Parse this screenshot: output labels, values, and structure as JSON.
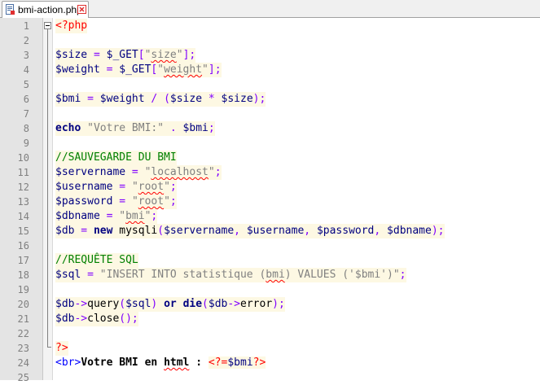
{
  "tab": {
    "filename": "bmi-action.php",
    "icon": "php-file-icon",
    "close_icon": "close-tab-icon",
    "modified_color": "#e03030"
  },
  "editor": {
    "lines": [
      {
        "num": "1",
        "php": true,
        "tokens": [
          {
            "t": "tag",
            "v": "<?php"
          }
        ]
      },
      {
        "num": "2",
        "php": true,
        "tokens": []
      },
      {
        "num": "3",
        "php": true,
        "tokens": [
          {
            "t": "var",
            "v": "$size"
          },
          {
            "t": "op",
            "v": " = "
          },
          {
            "t": "var",
            "v": "$_GET"
          },
          {
            "t": "op",
            "v": "["
          },
          {
            "t": "str",
            "v": "\""
          },
          {
            "t": "str",
            "v": "size",
            "spell": true
          },
          {
            "t": "str",
            "v": "\""
          },
          {
            "t": "op",
            "v": "];"
          }
        ]
      },
      {
        "num": "4",
        "php": true,
        "tokens": [
          {
            "t": "var",
            "v": "$weight"
          },
          {
            "t": "op",
            "v": " = "
          },
          {
            "t": "var",
            "v": "$_GET"
          },
          {
            "t": "op",
            "v": "["
          },
          {
            "t": "str",
            "v": "\""
          },
          {
            "t": "str",
            "v": "weight",
            "spell": true
          },
          {
            "t": "str",
            "v": "\""
          },
          {
            "t": "op",
            "v": "];"
          }
        ]
      },
      {
        "num": "5",
        "php": true,
        "tokens": []
      },
      {
        "num": "6",
        "php": true,
        "tokens": [
          {
            "t": "var",
            "v": "$bmi"
          },
          {
            "t": "op",
            "v": " = "
          },
          {
            "t": "var",
            "v": "$weight"
          },
          {
            "t": "op",
            "v": " / ("
          },
          {
            "t": "var",
            "v": "$size"
          },
          {
            "t": "op",
            "v": " * "
          },
          {
            "t": "var",
            "v": "$size"
          },
          {
            "t": "op",
            "v": ");"
          }
        ]
      },
      {
        "num": "7",
        "php": true,
        "tokens": []
      },
      {
        "num": "8",
        "php": true,
        "tokens": [
          {
            "t": "kw",
            "v": "echo"
          },
          {
            "t": "op",
            "v": " "
          },
          {
            "t": "str",
            "v": "\"Votre BMI:\""
          },
          {
            "t": "op",
            "v": " . "
          },
          {
            "t": "var",
            "v": "$bmi"
          },
          {
            "t": "op",
            "v": ";"
          }
        ]
      },
      {
        "num": "9",
        "php": true,
        "tokens": []
      },
      {
        "num": "10",
        "php": true,
        "tokens": [
          {
            "t": "cmt",
            "v": "//SAUVEGARDE DU BMI"
          }
        ]
      },
      {
        "num": "11",
        "php": true,
        "tokens": [
          {
            "t": "var",
            "v": "$servername"
          },
          {
            "t": "op",
            "v": " = "
          },
          {
            "t": "str",
            "v": "\""
          },
          {
            "t": "str",
            "v": "localhost",
            "spell": true
          },
          {
            "t": "str",
            "v": "\""
          },
          {
            "t": "op",
            "v": ";"
          }
        ]
      },
      {
        "num": "12",
        "php": true,
        "tokens": [
          {
            "t": "var",
            "v": "$username"
          },
          {
            "t": "op",
            "v": " = "
          },
          {
            "t": "str",
            "v": "\""
          },
          {
            "t": "str",
            "v": "root",
            "spell": true
          },
          {
            "t": "str",
            "v": "\""
          },
          {
            "t": "op",
            "v": ";"
          }
        ]
      },
      {
        "num": "13",
        "php": true,
        "tokens": [
          {
            "t": "var",
            "v": "$password"
          },
          {
            "t": "op",
            "v": " = "
          },
          {
            "t": "str",
            "v": "\""
          },
          {
            "t": "str",
            "v": "root",
            "spell": true
          },
          {
            "t": "str",
            "v": "\""
          },
          {
            "t": "op",
            "v": ";"
          }
        ]
      },
      {
        "num": "14",
        "php": true,
        "tokens": [
          {
            "t": "var",
            "v": "$dbname"
          },
          {
            "t": "op",
            "v": " = "
          },
          {
            "t": "str",
            "v": "\""
          },
          {
            "t": "str",
            "v": "bmi",
            "spell": true
          },
          {
            "t": "str",
            "v": "\""
          },
          {
            "t": "op",
            "v": ";"
          }
        ]
      },
      {
        "num": "15",
        "php": true,
        "tokens": [
          {
            "t": "var",
            "v": "$db"
          },
          {
            "t": "op",
            "v": " = "
          },
          {
            "t": "kw",
            "v": "new"
          },
          {
            "t": "op",
            "v": " "
          },
          {
            "t": "fn",
            "v": "mysqli"
          },
          {
            "t": "op",
            "v": "("
          },
          {
            "t": "var",
            "v": "$servername"
          },
          {
            "t": "op",
            "v": ", "
          },
          {
            "t": "var",
            "v": "$username"
          },
          {
            "t": "op",
            "v": ", "
          },
          {
            "t": "var",
            "v": "$password"
          },
          {
            "t": "op",
            "v": ", "
          },
          {
            "t": "var",
            "v": "$dbname"
          },
          {
            "t": "op",
            "v": ");"
          }
        ]
      },
      {
        "num": "16",
        "php": true,
        "tokens": []
      },
      {
        "num": "17",
        "php": true,
        "tokens": [
          {
            "t": "cmt",
            "v": "//REQUÊTE SQL"
          }
        ]
      },
      {
        "num": "18",
        "php": true,
        "tokens": [
          {
            "t": "var",
            "v": "$sql"
          },
          {
            "t": "op",
            "v": " = "
          },
          {
            "t": "str",
            "v": "\"INSERT INTO statistique ("
          },
          {
            "t": "str",
            "v": "bmi",
            "spell": true
          },
          {
            "t": "str",
            "v": ") VALUES ('$bmi')\""
          },
          {
            "t": "op",
            "v": ";"
          }
        ]
      },
      {
        "num": "19",
        "php": true,
        "tokens": []
      },
      {
        "num": "20",
        "php": true,
        "tokens": [
          {
            "t": "var",
            "v": "$db"
          },
          {
            "t": "op",
            "v": "->"
          },
          {
            "t": "fn",
            "v": "query"
          },
          {
            "t": "op",
            "v": "("
          },
          {
            "t": "var",
            "v": "$sql"
          },
          {
            "t": "op",
            "v": ") "
          },
          {
            "t": "kw",
            "v": "or"
          },
          {
            "t": "op",
            "v": " "
          },
          {
            "t": "kw",
            "v": "die"
          },
          {
            "t": "op",
            "v": "("
          },
          {
            "t": "var",
            "v": "$db"
          },
          {
            "t": "op",
            "v": "->"
          },
          {
            "t": "fn",
            "v": "error"
          },
          {
            "t": "op",
            "v": ");"
          }
        ]
      },
      {
        "num": "21",
        "php": true,
        "tokens": [
          {
            "t": "var",
            "v": "$db"
          },
          {
            "t": "op",
            "v": "->"
          },
          {
            "t": "fn",
            "v": "close"
          },
          {
            "t": "op",
            "v": "();"
          }
        ]
      },
      {
        "num": "22",
        "php": true,
        "tokens": []
      },
      {
        "num": "23",
        "php": true,
        "tokens": [
          {
            "t": "tag",
            "v": "?>"
          }
        ]
      },
      {
        "num": "24",
        "php": false,
        "tokens": [
          {
            "t": "html",
            "v": "<br>"
          },
          {
            "t": "text",
            "v": "Votre BMI en "
          },
          {
            "t": "text",
            "v": "html",
            "spell": true
          },
          {
            "t": "text",
            "v": " : "
          },
          {
            "t": "tag",
            "v": "<?=",
            "php": true
          },
          {
            "t": "var",
            "v": "$bmi",
            "php": true
          },
          {
            "t": "tag",
            "v": "?>",
            "php": true
          }
        ]
      },
      {
        "num": "25",
        "php": false,
        "tokens": []
      }
    ]
  }
}
